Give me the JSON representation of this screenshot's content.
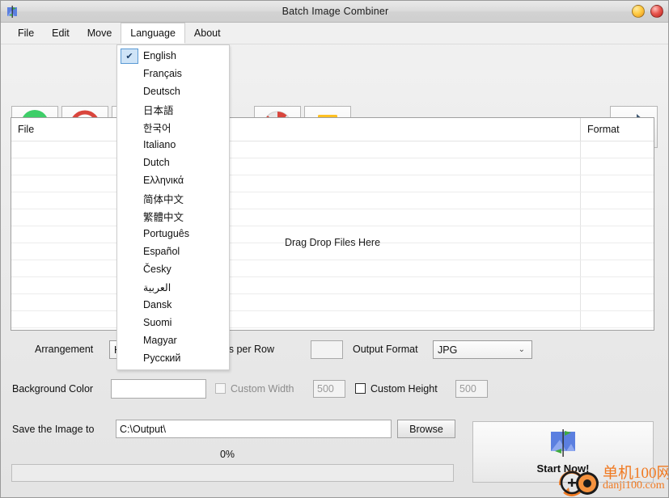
{
  "window": {
    "title": "Batch Image Combiner",
    "app_icon": "app-image-icon",
    "minimize_label": "",
    "close_label": ""
  },
  "menubar": {
    "items": [
      {
        "label": "File",
        "open": false
      },
      {
        "label": "Edit",
        "open": false
      },
      {
        "label": "Move",
        "open": false
      },
      {
        "label": "Language",
        "open": true
      },
      {
        "label": "About",
        "open": false
      }
    ]
  },
  "language_menu": {
    "open": true,
    "selected": "English",
    "items": [
      {
        "label": "English",
        "checked": true
      },
      {
        "label": "Français",
        "checked": false
      },
      {
        "label": "Deutsch",
        "checked": false
      },
      {
        "label": "日本語",
        "checked": false
      },
      {
        "label": "한국어",
        "checked": false
      },
      {
        "label": "Italiano",
        "checked": false
      },
      {
        "label": "Dutch",
        "checked": false
      },
      {
        "label": "Ελληνικά",
        "checked": false
      },
      {
        "label": "简体中文",
        "checked": false
      },
      {
        "label": "繁體中文",
        "checked": false
      },
      {
        "label": "Português",
        "checked": false
      },
      {
        "label": "Español",
        "checked": false
      },
      {
        "label": "Česky",
        "checked": false
      },
      {
        "label": "العربية",
        "checked": false
      },
      {
        "label": "Dansk",
        "checked": false
      },
      {
        "label": "Suomi",
        "checked": false
      },
      {
        "label": "Magyar",
        "checked": false
      },
      {
        "label": "Русский",
        "checked": false
      }
    ]
  },
  "toolbar": {
    "buttons": [
      {
        "icon": "add-plus-icon",
        "tooltip": ""
      },
      {
        "icon": "remove-forbidden-icon",
        "tooltip": ""
      },
      {
        "icon": "move-down-arrow-icon",
        "tooltip": ""
      },
      {
        "icon": "lifebuoy-help-icon",
        "tooltip": ""
      },
      {
        "icon": "shopping-bag-icon",
        "tooltip": ""
      },
      {
        "icon": "right-arrow-icon",
        "tooltip": ""
      }
    ]
  },
  "filelist": {
    "columns": [
      "File",
      "Format"
    ],
    "rows": [],
    "drop_hint": "Drag  Drop Files Here"
  },
  "options": {
    "arrangement_label": "Arrangement",
    "arrangement_value": "H",
    "images_per_row_label": "Images per Row",
    "images_per_row_value": "",
    "output_format_label": "Output Format",
    "output_format_value": "JPG",
    "background_color_label": "Background Color",
    "background_color_value": "#ffffff",
    "custom_width_label": "Custom Width",
    "custom_width_checked": false,
    "custom_width_enabled": false,
    "custom_width_value": "500",
    "custom_height_label": "Custom Height",
    "custom_height_checked": false,
    "custom_height_enabled": true,
    "custom_height_value": "500"
  },
  "save": {
    "label": "Save the Image to",
    "path_value": "C:\\Output\\",
    "browse_label": "Browse"
  },
  "progress": {
    "percent_label": "0%",
    "value": 0
  },
  "start": {
    "label": "Start Now!",
    "icon": "split-image-icon"
  },
  "watermark": {
    "line1": "单机100网",
    "line2": "danji100.com",
    "color": "#f07a22",
    "icon": "danji-logo-icon"
  }
}
